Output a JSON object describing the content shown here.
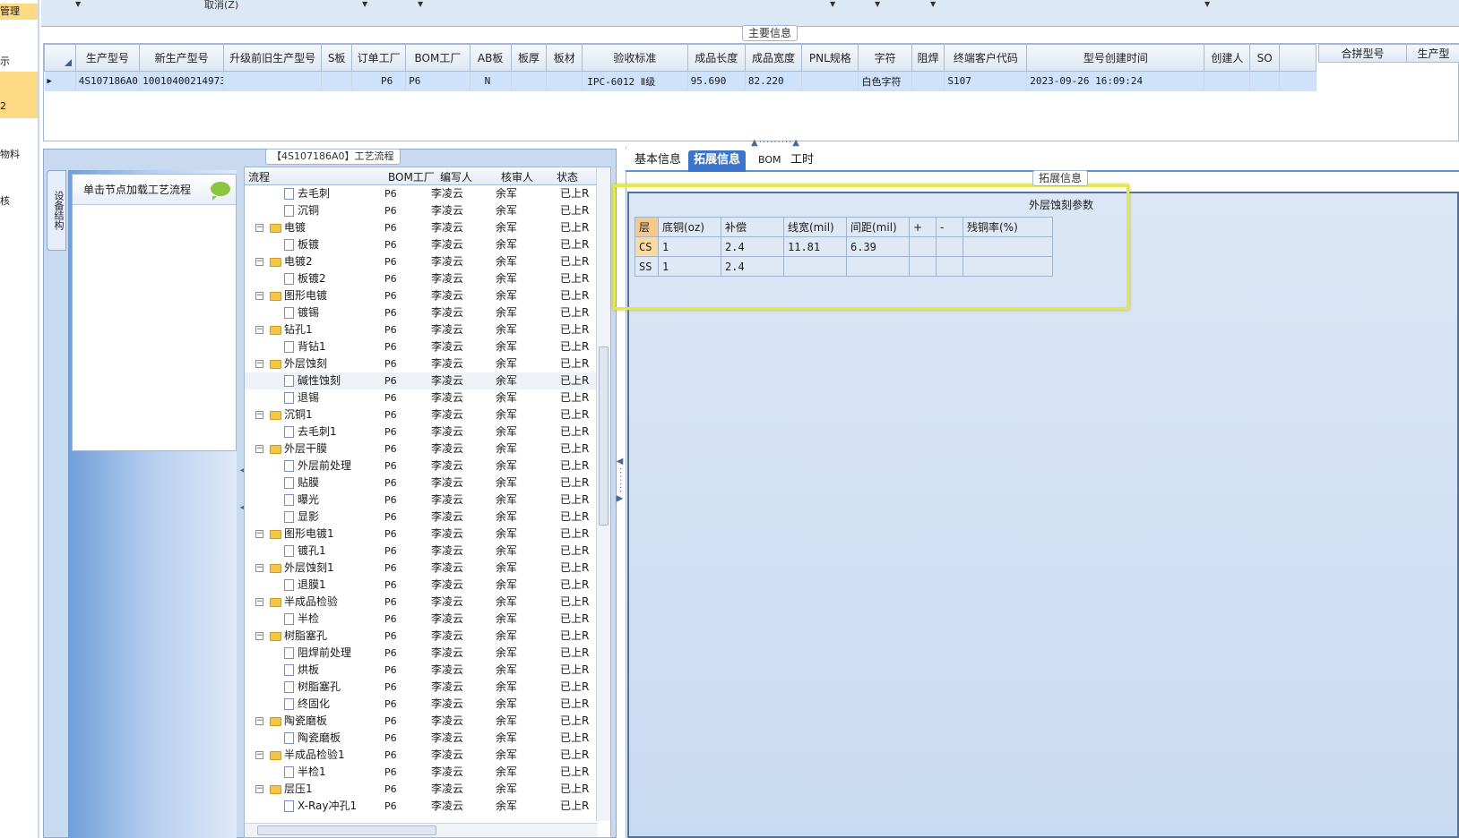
{
  "leftnav": {
    "items": [
      "管理",
      "示",
      "2",
      "物料",
      "核"
    ]
  },
  "toolbar": {
    "cancel_label": "取消(Z)"
  },
  "maininfo": {
    "group_title": "主要信息",
    "columns": [
      "生产型号",
      "新生产型号",
      "升级前旧生产型号",
      "S板",
      "订单工厂",
      "BOM工厂",
      "AB板",
      "板厚",
      "板材",
      "验收标准",
      "成品长度",
      "成品宽度",
      "PNL规格",
      "字符",
      "阻焊",
      "终端客户代码",
      "型号创建时间",
      "创建人",
      "SO"
    ],
    "row": [
      "4S107186A0",
      "10010400214973",
      "",
      "",
      "P6",
      "P6",
      "N",
      "",
      "",
      "IPC-6012 Ⅱ级",
      "95.690",
      "82.220",
      "",
      "白色字符",
      "",
      "S107",
      "2023-09-26 16:09:24",
      "",
      ""
    ],
    "right_columns": [
      "合拼型号",
      "生产型"
    ]
  },
  "process": {
    "group_title": "【4S107186A0】工艺流程",
    "side_tab": "设备结构",
    "node_hint": "单击节点加载工艺流程",
    "tree_columns": [
      "流程",
      "BOM工厂",
      "编写人",
      "核审人",
      "状态"
    ],
    "rows": [
      {
        "name": "去毛刺",
        "level": 2,
        "factory": "P6",
        "writer": "李凌云",
        "reviewer": "余军",
        "status": "已上R"
      },
      {
        "name": "沉铜",
        "level": 2,
        "factory": "P6",
        "writer": "李凌云",
        "reviewer": "余军",
        "status": "已上R"
      },
      {
        "name": "电镀",
        "level": 1,
        "factory": "P6",
        "writer": "李凌云",
        "reviewer": "余军",
        "status": "已上R"
      },
      {
        "name": "板镀",
        "level": 2,
        "factory": "P6",
        "writer": "李凌云",
        "reviewer": "余军",
        "status": "已上R"
      },
      {
        "name": "电镀2",
        "level": 1,
        "factory": "P6",
        "writer": "李凌云",
        "reviewer": "余军",
        "status": "已上R"
      },
      {
        "name": "板镀2",
        "level": 2,
        "factory": "P6",
        "writer": "李凌云",
        "reviewer": "余军",
        "status": "已上R"
      },
      {
        "name": "图形电镀",
        "level": 1,
        "factory": "P6",
        "writer": "李凌云",
        "reviewer": "余军",
        "status": "已上R"
      },
      {
        "name": "镀锡",
        "level": 2,
        "factory": "P6",
        "writer": "李凌云",
        "reviewer": "余军",
        "status": "已上R"
      },
      {
        "name": "钻孔1",
        "level": 1,
        "factory": "P6",
        "writer": "李凌云",
        "reviewer": "余军",
        "status": "已上R"
      },
      {
        "name": "背钻1",
        "level": 2,
        "factory": "P6",
        "writer": "李凌云",
        "reviewer": "余军",
        "status": "已上R"
      },
      {
        "name": "外层蚀刻",
        "level": 1,
        "factory": "P6",
        "writer": "李凌云",
        "reviewer": "余军",
        "status": "已上R"
      },
      {
        "name": "碱性蚀刻",
        "level": 2,
        "factory": "P6",
        "writer": "李凌云",
        "reviewer": "余军",
        "status": "已上R",
        "selected": true
      },
      {
        "name": "退锡",
        "level": 2,
        "factory": "P6",
        "writer": "李凌云",
        "reviewer": "余军",
        "status": "已上R"
      },
      {
        "name": "沉铜1",
        "level": 1,
        "factory": "P6",
        "writer": "李凌云",
        "reviewer": "余军",
        "status": "已上R"
      },
      {
        "name": "去毛刺1",
        "level": 2,
        "factory": "P6",
        "writer": "李凌云",
        "reviewer": "余军",
        "status": "已上R"
      },
      {
        "name": "外层干膜",
        "level": 1,
        "factory": "P6",
        "writer": "李凌云",
        "reviewer": "余军",
        "status": "已上R"
      },
      {
        "name": "外层前处理",
        "level": 2,
        "factory": "P6",
        "writer": "李凌云",
        "reviewer": "余军",
        "status": "已上R"
      },
      {
        "name": "贴膜",
        "level": 2,
        "factory": "P6",
        "writer": "李凌云",
        "reviewer": "余军",
        "status": "已上R"
      },
      {
        "name": "曝光",
        "level": 2,
        "factory": "P6",
        "writer": "李凌云",
        "reviewer": "余军",
        "status": "已上R"
      },
      {
        "name": "显影",
        "level": 2,
        "factory": "P6",
        "writer": "李凌云",
        "reviewer": "余军",
        "status": "已上R"
      },
      {
        "name": "图形电镀1",
        "level": 1,
        "factory": "P6",
        "writer": "李凌云",
        "reviewer": "余军",
        "status": "已上R"
      },
      {
        "name": "镀孔1",
        "level": 2,
        "factory": "P6",
        "writer": "李凌云",
        "reviewer": "余军",
        "status": "已上R"
      },
      {
        "name": "外层蚀刻1",
        "level": 1,
        "factory": "P6",
        "writer": "李凌云",
        "reviewer": "余军",
        "status": "已上R"
      },
      {
        "name": "退膜1",
        "level": 2,
        "factory": "P6",
        "writer": "李凌云",
        "reviewer": "余军",
        "status": "已上R"
      },
      {
        "name": "半成品检验",
        "level": 1,
        "factory": "P6",
        "writer": "李凌云",
        "reviewer": "余军",
        "status": "已上R"
      },
      {
        "name": "半检",
        "level": 2,
        "factory": "P6",
        "writer": "李凌云",
        "reviewer": "余军",
        "status": "已上R"
      },
      {
        "name": "树脂塞孔",
        "level": 1,
        "factory": "P6",
        "writer": "李凌云",
        "reviewer": "余军",
        "status": "已上R"
      },
      {
        "name": "阻焊前处理",
        "level": 2,
        "factory": "P6",
        "writer": "李凌云",
        "reviewer": "余军",
        "status": "已上R"
      },
      {
        "name": "烘板",
        "level": 2,
        "factory": "P6",
        "writer": "李凌云",
        "reviewer": "余军",
        "status": "已上R"
      },
      {
        "name": "树脂塞孔",
        "level": 2,
        "factory": "P6",
        "writer": "李凌云",
        "reviewer": "余军",
        "status": "已上R"
      },
      {
        "name": "终固化",
        "level": 2,
        "factory": "P6",
        "writer": "李凌云",
        "reviewer": "余军",
        "status": "已上R"
      },
      {
        "name": "陶瓷磨板",
        "level": 1,
        "factory": "P6",
        "writer": "李凌云",
        "reviewer": "余军",
        "status": "已上R"
      },
      {
        "name": "陶瓷磨板",
        "level": 2,
        "factory": "P6",
        "writer": "李凌云",
        "reviewer": "余军",
        "status": "已上R"
      },
      {
        "name": "半成品检验1",
        "level": 1,
        "factory": "P6",
        "writer": "李凌云",
        "reviewer": "余军",
        "status": "已上R"
      },
      {
        "name": "半检1",
        "level": 2,
        "factory": "P6",
        "writer": "李凌云",
        "reviewer": "余军",
        "status": "已上R"
      },
      {
        "name": "层压1",
        "level": 1,
        "factory": "P6",
        "writer": "李凌云",
        "reviewer": "余军",
        "status": "已上R"
      },
      {
        "name": "X-Ray冲孔1",
        "level": 2,
        "factory": "P6",
        "writer": "李凌云",
        "reviewer": "余军",
        "status": "已上R"
      }
    ]
  },
  "detail": {
    "tabs": [
      "基本信息",
      "拓展信息",
      "BOM",
      "工时"
    ],
    "active_tab": 1,
    "ext_title": "拓展信息",
    "etch_caption": "外层蚀刻参数",
    "etch_columns": [
      "层",
      "底铜(oz)",
      "补偿",
      "线宽(mil)",
      "间距(mil)",
      "+",
      "-",
      "残铜率(%)"
    ],
    "etch_rows": [
      [
        "CS",
        "1",
        "2.4",
        "11.81",
        "6.39",
        "",
        "",
        ""
      ],
      [
        "SS",
        "1",
        "2.4",
        "",
        "",
        "",
        "",
        ""
      ]
    ]
  },
  "colors": {
    "accent": "#3b74c9",
    "highlight_box": "#e4e84a",
    "selected_row": "#cfe2fb",
    "nav_selected": "#fcd982"
  }
}
